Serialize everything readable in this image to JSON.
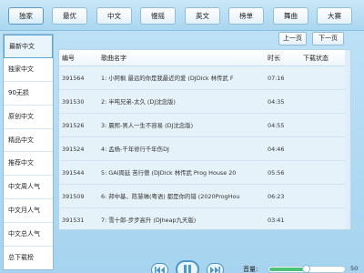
{
  "tabs": [
    {
      "label": "独家",
      "active": true
    },
    {
      "label": "最优"
    },
    {
      "label": "中文"
    },
    {
      "label": "慢摇"
    },
    {
      "label": "英文"
    },
    {
      "label": "榜单"
    },
    {
      "label": "舞曲"
    },
    {
      "label": "大赛"
    }
  ],
  "paging": {
    "prev": "上一页",
    "next": "下一页"
  },
  "sidebar": {
    "items": [
      {
        "label": "最新中文",
        "active": true
      },
      {
        "label": "独家中文"
      },
      {
        "label": "90无损"
      },
      {
        "label": "原创中文"
      },
      {
        "label": "精品中文"
      },
      {
        "label": "推荐中文"
      },
      {
        "label": "中文周人气"
      },
      {
        "label": "中文月人气"
      },
      {
        "label": "中文总人气"
      },
      {
        "label": "总下载榜"
      }
    ]
  },
  "table": {
    "headers": {
      "id": "编号",
      "name": "歌曲名字",
      "time": "时长",
      "download": "下载状态"
    },
    "rows": [
      {
        "id": "391564",
        "name": "1: 小阿枫  最远的你是我最近的爱 (DJDick 林传武 F",
        "time": "07:16",
        "download": ""
      },
      {
        "id": "391530",
        "name": "2: 半吨兄弟-太久 (DJ沈念版)",
        "time": "04:35",
        "download": ""
      },
      {
        "id": "391526",
        "name": "3: 晨熙-男人一生不容易 (DJ沈念版)",
        "time": "04:55",
        "download": ""
      },
      {
        "id": "391524",
        "name": "4: 孟杨-千年修行千年伤DJ",
        "time": "04:46",
        "download": ""
      },
      {
        "id": "391544",
        "name": "5: GAI周延 苦行僧 (DJDick 林传武 Prog House 20",
        "time": "05:56",
        "download": ""
      },
      {
        "id": "391509",
        "name": "6: 邦中基、陈慧琳(粤语) 都是你的错 (2020ProgHou",
        "time": "06:23",
        "download": ""
      },
      {
        "id": "391531",
        "name": "7: 雪十郎-步步高升 (DJheap九天版)",
        "time": "03:41",
        "download": ""
      }
    ]
  },
  "player": {
    "volume_label": "音量:",
    "volume": 50,
    "volume_text": "50",
    "progress": 0.0,
    "time_text": "00:00",
    "accent": "#4d97c9",
    "volume_color": "#4cc27a"
  }
}
